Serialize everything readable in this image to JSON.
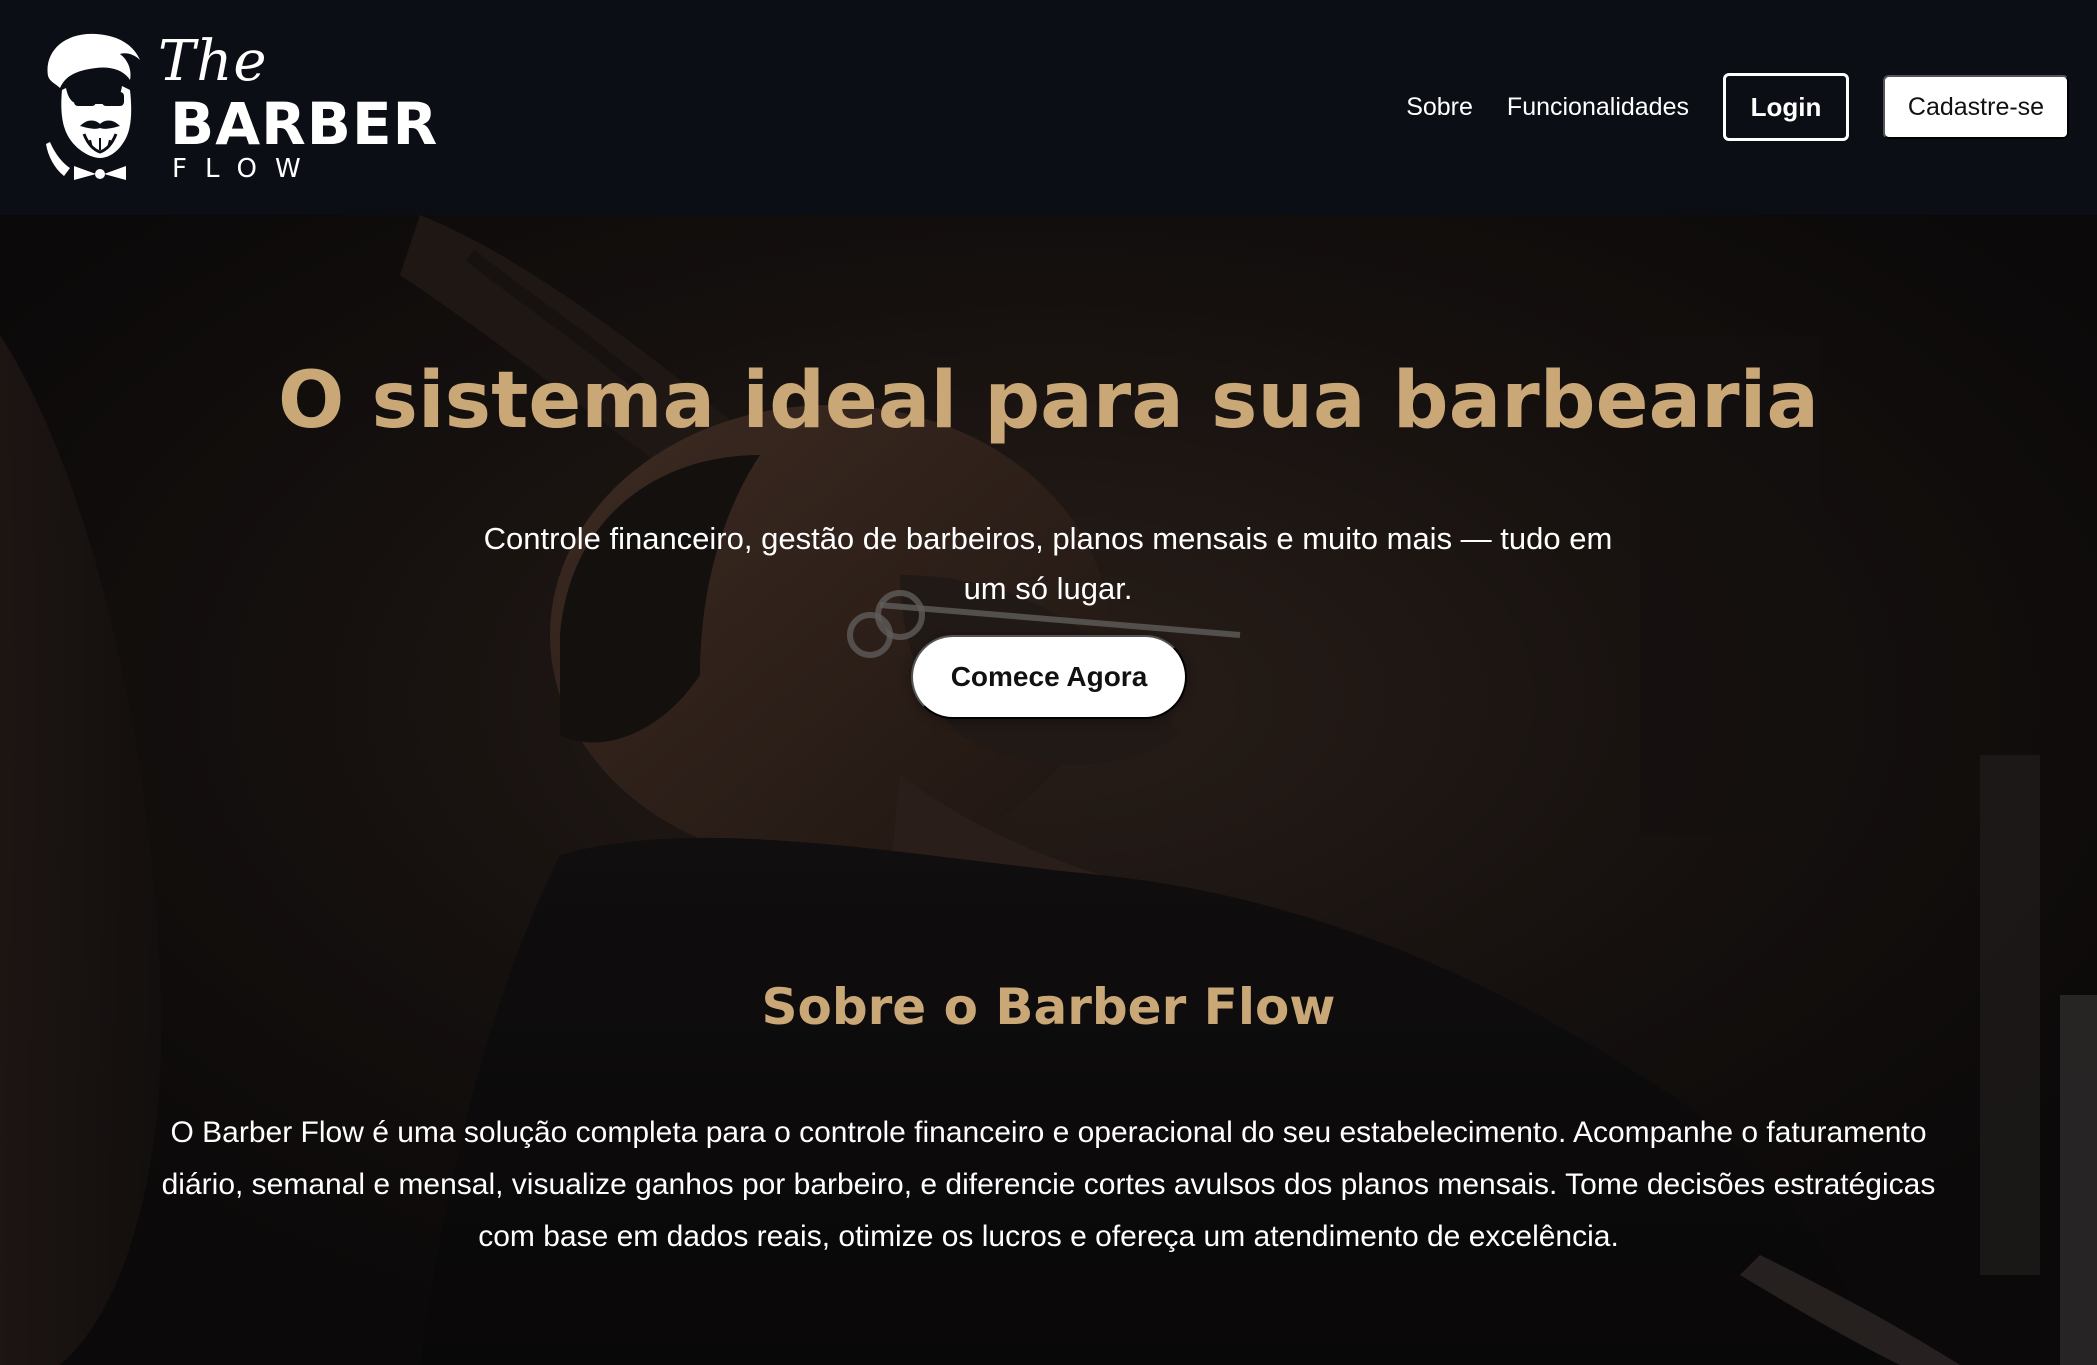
{
  "brand": {
    "the": "The",
    "barber": "BARBER",
    "flow": "FLOW"
  },
  "nav": {
    "sobre": "Sobre",
    "funcionalidades": "Funcionalidades",
    "login": "Login",
    "cadastro": "Cadastre-se"
  },
  "hero": {
    "title": "O sistema ideal para sua barbearia",
    "subtitle": "Controle financeiro, gestão de barbeiros, planos mensais e muito mais — tudo em um só lugar.",
    "cta": "Comece Agora"
  },
  "about": {
    "title": "Sobre o Barber Flow",
    "text": "O Barber Flow é uma solução completa para o controle financeiro e operacional do seu estabelecimento. Acompanhe o faturamento diário, semanal e mensal, visualize ganhos por barbeiro, e diferencie cortes avulsos dos planos mensais. Tome decisões estratégicas com base em dados reais, otimize os lucros e ofereça um atendimento de excelência."
  },
  "colors": {
    "accent": "#c9a776",
    "header_bg": "#0b0f15",
    "button_bg": "#ffffff"
  },
  "icons": {
    "logo": "bearded-man-logo-icon"
  }
}
